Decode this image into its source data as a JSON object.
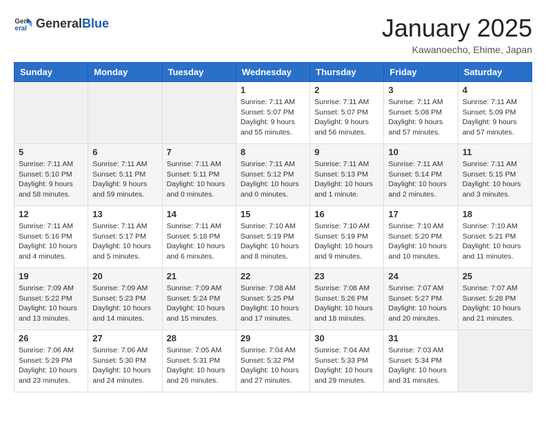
{
  "header": {
    "logo_general": "General",
    "logo_blue": "Blue",
    "month_title": "January 2025",
    "location": "Kawanoecho, Ehime, Japan"
  },
  "weekdays": [
    "Sunday",
    "Monday",
    "Tuesday",
    "Wednesday",
    "Thursday",
    "Friday",
    "Saturday"
  ],
  "weeks": [
    [
      {
        "day": "",
        "info": ""
      },
      {
        "day": "",
        "info": ""
      },
      {
        "day": "",
        "info": ""
      },
      {
        "day": "1",
        "info": "Sunrise: 7:11 AM\nSunset: 5:07 PM\nDaylight: 9 hours\nand 55 minutes."
      },
      {
        "day": "2",
        "info": "Sunrise: 7:11 AM\nSunset: 5:07 PM\nDaylight: 9 hours\nand 56 minutes."
      },
      {
        "day": "3",
        "info": "Sunrise: 7:11 AM\nSunset: 5:08 PM\nDaylight: 9 hours\nand 57 minutes."
      },
      {
        "day": "4",
        "info": "Sunrise: 7:11 AM\nSunset: 5:09 PM\nDaylight: 9 hours\nand 57 minutes."
      }
    ],
    [
      {
        "day": "5",
        "info": "Sunrise: 7:11 AM\nSunset: 5:10 PM\nDaylight: 9 hours\nand 58 minutes."
      },
      {
        "day": "6",
        "info": "Sunrise: 7:11 AM\nSunset: 5:11 PM\nDaylight: 9 hours\nand 59 minutes."
      },
      {
        "day": "7",
        "info": "Sunrise: 7:11 AM\nSunset: 5:11 PM\nDaylight: 10 hours\nand 0 minutes."
      },
      {
        "day": "8",
        "info": "Sunrise: 7:11 AM\nSunset: 5:12 PM\nDaylight: 10 hours\nand 0 minutes."
      },
      {
        "day": "9",
        "info": "Sunrise: 7:11 AM\nSunset: 5:13 PM\nDaylight: 10 hours\nand 1 minute."
      },
      {
        "day": "10",
        "info": "Sunrise: 7:11 AM\nSunset: 5:14 PM\nDaylight: 10 hours\nand 2 minutes."
      },
      {
        "day": "11",
        "info": "Sunrise: 7:11 AM\nSunset: 5:15 PM\nDaylight: 10 hours\nand 3 minutes."
      }
    ],
    [
      {
        "day": "12",
        "info": "Sunrise: 7:11 AM\nSunset: 5:16 PM\nDaylight: 10 hours\nand 4 minutes."
      },
      {
        "day": "13",
        "info": "Sunrise: 7:11 AM\nSunset: 5:17 PM\nDaylight: 10 hours\nand 5 minutes."
      },
      {
        "day": "14",
        "info": "Sunrise: 7:11 AM\nSunset: 5:18 PM\nDaylight: 10 hours\nand 6 minutes."
      },
      {
        "day": "15",
        "info": "Sunrise: 7:10 AM\nSunset: 5:19 PM\nDaylight: 10 hours\nand 8 minutes."
      },
      {
        "day": "16",
        "info": "Sunrise: 7:10 AM\nSunset: 5:19 PM\nDaylight: 10 hours\nand 9 minutes."
      },
      {
        "day": "17",
        "info": "Sunrise: 7:10 AM\nSunset: 5:20 PM\nDaylight: 10 hours\nand 10 minutes."
      },
      {
        "day": "18",
        "info": "Sunrise: 7:10 AM\nSunset: 5:21 PM\nDaylight: 10 hours\nand 11 minutes."
      }
    ],
    [
      {
        "day": "19",
        "info": "Sunrise: 7:09 AM\nSunset: 5:22 PM\nDaylight: 10 hours\nand 13 minutes."
      },
      {
        "day": "20",
        "info": "Sunrise: 7:09 AM\nSunset: 5:23 PM\nDaylight: 10 hours\nand 14 minutes."
      },
      {
        "day": "21",
        "info": "Sunrise: 7:09 AM\nSunset: 5:24 PM\nDaylight: 10 hours\nand 15 minutes."
      },
      {
        "day": "22",
        "info": "Sunrise: 7:08 AM\nSunset: 5:25 PM\nDaylight: 10 hours\nand 17 minutes."
      },
      {
        "day": "23",
        "info": "Sunrise: 7:08 AM\nSunset: 5:26 PM\nDaylight: 10 hours\nand 18 minutes."
      },
      {
        "day": "24",
        "info": "Sunrise: 7:07 AM\nSunset: 5:27 PM\nDaylight: 10 hours\nand 20 minutes."
      },
      {
        "day": "25",
        "info": "Sunrise: 7:07 AM\nSunset: 5:28 PM\nDaylight: 10 hours\nand 21 minutes."
      }
    ],
    [
      {
        "day": "26",
        "info": "Sunrise: 7:06 AM\nSunset: 5:29 PM\nDaylight: 10 hours\nand 23 minutes."
      },
      {
        "day": "27",
        "info": "Sunrise: 7:06 AM\nSunset: 5:30 PM\nDaylight: 10 hours\nand 24 minutes."
      },
      {
        "day": "28",
        "info": "Sunrise: 7:05 AM\nSunset: 5:31 PM\nDaylight: 10 hours\nand 26 minutes."
      },
      {
        "day": "29",
        "info": "Sunrise: 7:04 AM\nSunset: 5:32 PM\nDaylight: 10 hours\nand 27 minutes."
      },
      {
        "day": "30",
        "info": "Sunrise: 7:04 AM\nSunset: 5:33 PM\nDaylight: 10 hours\nand 29 minutes."
      },
      {
        "day": "31",
        "info": "Sunrise: 7:03 AM\nSunset: 5:34 PM\nDaylight: 10 hours\nand 31 minutes."
      },
      {
        "day": "",
        "info": ""
      }
    ]
  ]
}
